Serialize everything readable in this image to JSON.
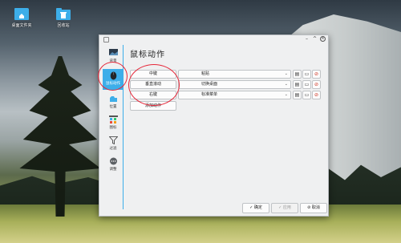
{
  "desktop": {
    "icons": [
      {
        "label": "桌面文件夹",
        "icon": "home-folder-icon"
      },
      {
        "label": "回收站",
        "icon": "trash-icon"
      }
    ]
  },
  "window": {
    "title_glyphs": {
      "menu": "▢",
      "minimize": "–",
      "maximize": "^",
      "close": "×"
    },
    "sidebar": [
      {
        "label": "背景",
        "icon": "wallpaper-icon",
        "active": false
      },
      {
        "label": "鼠标动作",
        "icon": "mouse-icon",
        "active": true
      },
      {
        "label": "位置",
        "icon": "location-icon",
        "active": false
      },
      {
        "label": "图标",
        "icon": "icons-grid-icon",
        "active": false
      },
      {
        "label": "过滤",
        "icon": "filter-icon",
        "active": false
      },
      {
        "label": "调整",
        "icon": "more-icon",
        "active": false
      }
    ],
    "page_title": "鼠标动作",
    "actions": [
      {
        "trigger": "中键",
        "action": "粘贴"
      },
      {
        "trigger": "垂直滚动",
        "action": "切换桌面"
      },
      {
        "trigger": "右键",
        "action": "标准菜单"
      }
    ],
    "add_action_label": "添加动作",
    "footer": {
      "ok": "✓ 确定",
      "apply": "✓ 应用",
      "cancel": "⊘ 取消"
    },
    "accent_color": "#3daee9",
    "highlight_color": "#e6283a"
  }
}
